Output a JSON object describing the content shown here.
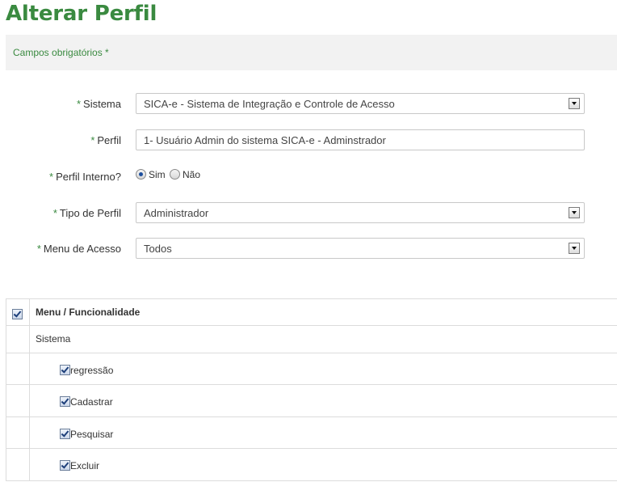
{
  "page": {
    "title": "Alterar Perfil"
  },
  "notice": {
    "text": "Campos obrigatórios *"
  },
  "form": {
    "required_mark": "*",
    "sistema": {
      "label": "Sistema",
      "value": "SICA-e - Sistema de Integração e Controle de Acesso"
    },
    "perfil": {
      "label": "Perfil",
      "value": "1- Usuário Admin do sistema SICA-e - Adminstrador"
    },
    "perfil_interno": {
      "label": "Perfil Interno?",
      "options": [
        {
          "label": "Sim",
          "checked": true
        },
        {
          "label": "Não",
          "checked": false
        }
      ]
    },
    "tipo_perfil": {
      "label": "Tipo de Perfil",
      "value": "Administrador"
    },
    "menu_acesso": {
      "label": "Menu de Acesso",
      "value": "Todos"
    }
  },
  "table": {
    "header": "Menu / Funcionalidade",
    "group": "Sistema",
    "items": [
      "regressão",
      "Cadastrar",
      "Pesquisar",
      "Excluir"
    ]
  },
  "colors": {
    "accent": "#3a8a40",
    "notice_bg": "#f2f2f2"
  }
}
